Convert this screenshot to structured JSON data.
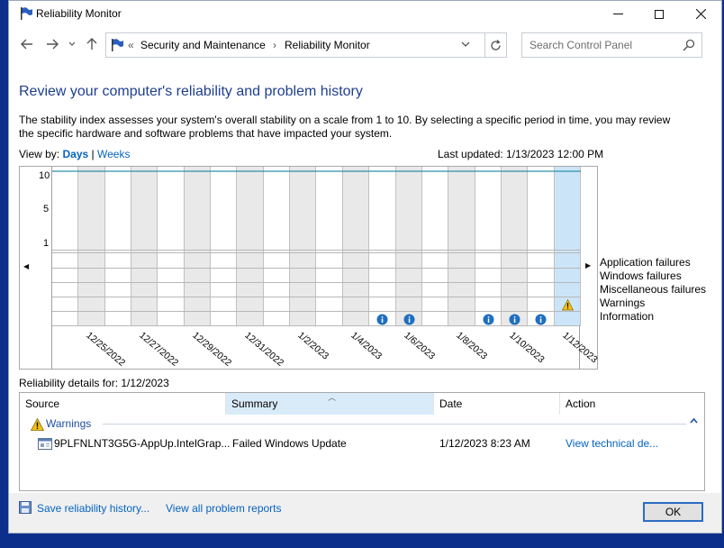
{
  "window": {
    "title": "Reliability Monitor"
  },
  "address": {
    "overflow": "«",
    "crumbs": [
      "Security and Maintenance",
      "Reliability Monitor"
    ],
    "separator": "›"
  },
  "search": {
    "placeholder": "Search Control Panel"
  },
  "page": {
    "heading": "Review your computer's reliability and problem history",
    "description": "The stability index assesses your system's overall stability on a scale from 1 to 10. By selecting a specific period in time, you may review the specific hardware and software problems that have impacted your system.",
    "view_by_label": "View by:",
    "view_days": "Days",
    "view_sep": "|",
    "view_weeks": "Weeks",
    "view_selected": "Days",
    "last_updated": "Last updated: 1/13/2023 12:00 PM"
  },
  "chart_data": {
    "type": "line",
    "y_ticks": [
      "10",
      "5",
      "1"
    ],
    "ylim": [
      1,
      10
    ],
    "x": [
      "12/24/2022",
      "12/25/2022",
      "12/26/2022",
      "12/27/2022",
      "12/28/2022",
      "12/29/2022",
      "12/30/2022",
      "12/31/2022",
      "1/1/2023",
      "1/2/2023",
      "1/3/2023",
      "1/4/2023",
      "1/5/2023",
      "1/6/2023",
      "1/7/2023",
      "1/8/2023",
      "1/9/2023",
      "1/10/2023",
      "1/11/2023",
      "1/12/2023"
    ],
    "x_tick_labels": [
      "12/25/2022",
      "12/27/2022",
      "12/29/2022",
      "12/31/2022",
      "1/2/2023",
      "1/4/2023",
      "1/6/2023",
      "1/8/2023",
      "1/10/2023",
      "1/12/2023"
    ],
    "stability_index": [
      10,
      10,
      10,
      10,
      10,
      10,
      10,
      10,
      10,
      10,
      10,
      10,
      10,
      10,
      10,
      10,
      10,
      10,
      10,
      10
    ],
    "selected_date": "1/12/2023",
    "event_rows": [
      "Application failures",
      "Windows failures",
      "Miscellaneous failures",
      "Warnings",
      "Information"
    ],
    "events": [
      {
        "date": "1/5/2023",
        "row": "Information"
      },
      {
        "date": "1/6/2023",
        "row": "Information"
      },
      {
        "date": "1/9/2023",
        "row": "Information"
      },
      {
        "date": "1/10/2023",
        "row": "Information"
      },
      {
        "date": "1/11/2023",
        "row": "Information"
      },
      {
        "date": "1/12/2023",
        "row": "Warnings"
      }
    ],
    "colors": {
      "stability_line": "#2f8fa8",
      "shaded_column": "#e9e9e9",
      "selected_column": "#cce4f7",
      "info_icon": "#1e6fc0",
      "warn_icon": "#f2c01a"
    }
  },
  "details": {
    "label": "Reliability details for: 1/12/2023",
    "columns": [
      "Source",
      "Summary",
      "Date",
      "Action"
    ],
    "sorted_column": "Summary",
    "group": "Warnings",
    "rows": [
      {
        "source": "9PLFNLNT3G5G-AppUp.IntelGrap...",
        "summary": "Failed Windows Update",
        "date": "1/12/2023 8:23 AM",
        "action": "View technical de..."
      }
    ]
  },
  "footer": {
    "save_link": "Save reliability history...",
    "view_all_link": "View all problem reports",
    "ok_label": "OK"
  },
  "icons": {
    "app": "flag-icon",
    "back": "back-arrow-icon",
    "forward": "forward-arrow-icon",
    "recent": "chevron-down-icon",
    "up": "up-arrow-icon",
    "refresh": "refresh-icon",
    "search": "search-icon"
  }
}
